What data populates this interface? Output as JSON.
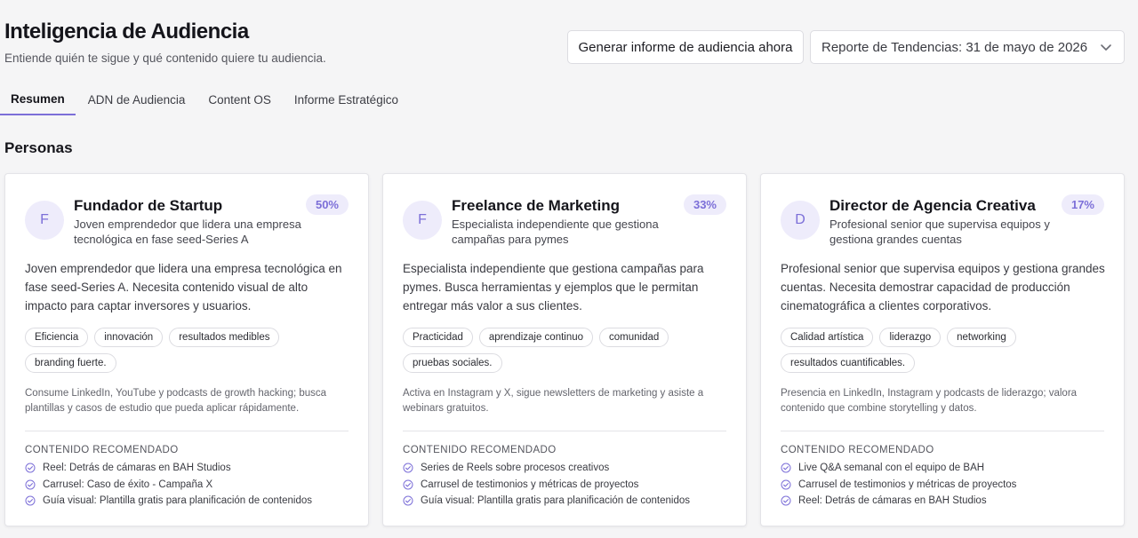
{
  "header": {
    "title": "Inteligencia de Audiencia",
    "subtitle": "Entiende quién te sigue y qué contenido quiere tu audiencia."
  },
  "actions": {
    "generate_label": "Generar informe de audiencia ahora",
    "report_selected": "Reporte de Tendencias: 31 de mayo de 2026"
  },
  "tabs": [
    {
      "label": "Resumen",
      "active": true
    },
    {
      "label": "ADN de Audiencia",
      "active": false
    },
    {
      "label": "Content OS",
      "active": false
    },
    {
      "label": "Informe Estratégico",
      "active": false
    }
  ],
  "section_title": "Personas",
  "rec_heading": "CONTENIDO RECOMENDADO",
  "colors": {
    "accent": "#7c6fd8",
    "accent_bg": "#eeecfb"
  },
  "icons": {
    "check": "check-circle-icon",
    "chevron": "chevron-down-icon"
  },
  "personas": [
    {
      "initial": "F",
      "name": "Fundador de Startup",
      "short": "Joven emprendedor que lidera una empresa tecnológica en fase seed-Series A",
      "percent": "50%",
      "description": "Joven emprendedor que lidera una empresa tecnológica en fase seed-Series A. Necesita contenido visual de alto impacto para captar inversores y usuarios.",
      "tags": [
        "Eficiencia",
        "innovación",
        "resultados medibles",
        "branding fuerte."
      ],
      "consumption": "Consume LinkedIn, YouTube y podcasts de growth hacking; busca plantillas y casos de estudio que pueda aplicar rápidamente.",
      "recommended": [
        "Reel: Detrás de cámaras en BAH Studios",
        "Carrusel: Caso de éxito - Campaña X",
        "Guía visual: Plantilla gratis para planificación de contenidos"
      ]
    },
    {
      "initial": "F",
      "name": "Freelance de Marketing",
      "short": "Especialista independiente que gestiona campañas para pymes",
      "percent": "33%",
      "description": "Especialista independiente que gestiona campañas para pymes. Busca herramientas y ejemplos que le permitan entregar más valor a sus clientes.",
      "tags": [
        "Practicidad",
        "aprendizaje continuo",
        "comunidad",
        "pruebas sociales."
      ],
      "consumption": "Activa en Instagram y X, sigue newsletters de marketing y asiste a webinars gratuitos.",
      "recommended": [
        "Series de Reels sobre procesos creativos",
        "Carrusel de testimonios y métricas de proyectos",
        "Guía visual: Plantilla gratis para planificación de contenidos"
      ]
    },
    {
      "initial": "D",
      "name": "Director de Agencia Creativa",
      "short": "Profesional senior que supervisa equipos y gestiona grandes cuentas",
      "percent": "17%",
      "description": "Profesional senior que supervisa equipos y gestiona grandes cuentas. Necesita demostrar capacidad de producción cinematográfica a clientes corporativos.",
      "tags": [
        "Calidad artística",
        "liderazgo",
        "networking",
        "resultados cuantificables."
      ],
      "consumption": "Presencia en LinkedIn, Instagram y podcasts de liderazgo; valora contenido que combine storytelling y datos.",
      "recommended": [
        "Live Q&A semanal con el equipo de BAH",
        "Carrusel de testimonios y métricas de proyectos",
        "Reel: Detrás de cámaras en BAH Studios"
      ]
    }
  ]
}
